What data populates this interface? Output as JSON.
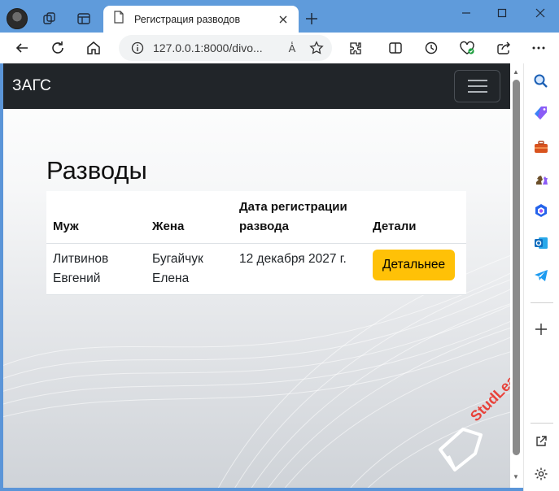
{
  "browser": {
    "tab_title": "Регистрация разводов",
    "url": "127.0.0.1:8000/divo...",
    "read_aloud_label": "A̒",
    "colors": {
      "titlebar": "#5f9bdb",
      "navbar": "#212529",
      "button": "#ffc107",
      "watermark": "#e8423a"
    }
  },
  "page": {
    "brand": "ЗАГС",
    "heading": "Разводы",
    "table": {
      "headers": [
        "Муж",
        "Жена",
        "Дата регистрации развода",
        "Детали"
      ],
      "rows": [
        {
          "husband": "Литвинов Евгений",
          "wife": "Бугайчук Елена",
          "date": "12 декабря 2027 г.",
          "details_label": "Детальнее"
        }
      ]
    },
    "watermark": "StudLearn"
  },
  "icons": {
    "sidebar": [
      "search-icon",
      "tag-icon",
      "briefcase-icon",
      "chess-icon",
      "copilot-icon",
      "outlook-icon",
      "telegram-icon",
      "add-icon",
      "external-link-icon",
      "settings-icon"
    ]
  }
}
